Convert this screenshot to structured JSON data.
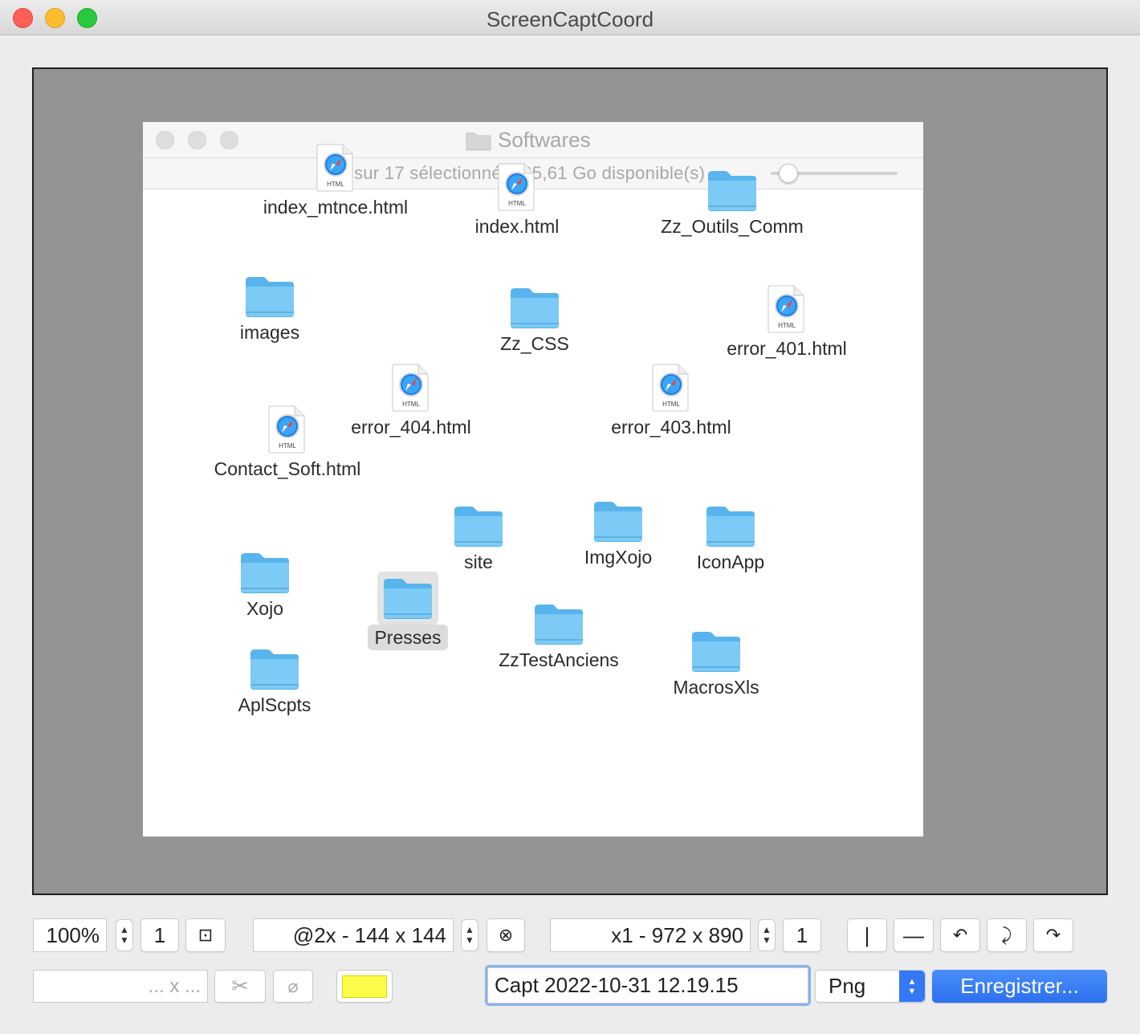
{
  "window": {
    "title": "ScreenCaptCoord"
  },
  "finder": {
    "title": "Softwares",
    "status": "1 sur 17 sélectionné, 135,61 Go disponible(s)",
    "items": [
      {
        "label": "index_mtnce.html",
        "kind": "html"
      },
      {
        "label": "index.html",
        "kind": "html"
      },
      {
        "label": "Zz_Outils_Comm",
        "kind": "folder"
      },
      {
        "label": "images",
        "kind": "folder"
      },
      {
        "label": "Zz_CSS",
        "kind": "folder"
      },
      {
        "label": "error_401.html",
        "kind": "html"
      },
      {
        "label": "error_404.html",
        "kind": "html"
      },
      {
        "label": "error_403.html",
        "kind": "html"
      },
      {
        "label": "Contact_Soft.html",
        "kind": "html"
      },
      {
        "label": "site",
        "kind": "folder"
      },
      {
        "label": "ImgXojo",
        "kind": "folder"
      },
      {
        "label": "IconApp",
        "kind": "folder"
      },
      {
        "label": "Xojo",
        "kind": "folder"
      },
      {
        "label": "Presses",
        "kind": "folder",
        "selected": true
      },
      {
        "label": "ZzTestAnciens",
        "kind": "folder"
      },
      {
        "label": "MacrosXls",
        "kind": "folder"
      },
      {
        "label": "AplScpts",
        "kind": "folder"
      }
    ],
    "html_badge": "HTML"
  },
  "toolbar": {
    "zoom": "100%",
    "zoom_count": "1",
    "fit_glyph": "⊡",
    "scale_field": "@2x - 144 x 144",
    "clear_glyph": "⊗",
    "size_field": "x1 - 972 x 890",
    "size_count": "1",
    "vertical_line": "|",
    "horizontal_line": "—",
    "rotate_left": "↶",
    "rotate_down": "⤸",
    "rotate_right": "↷",
    "coords_placeholder": "... x ...",
    "cut_glyph": "✂",
    "none_glyph": "⌀",
    "color_swatch": "#fbfb4a",
    "filename": "Capt 2022-10-31 12.19.15",
    "format": "Png",
    "save_label": "Enregistrer..."
  },
  "colors": {
    "accent": "#3478f6",
    "folder": "#6dc3f2"
  }
}
